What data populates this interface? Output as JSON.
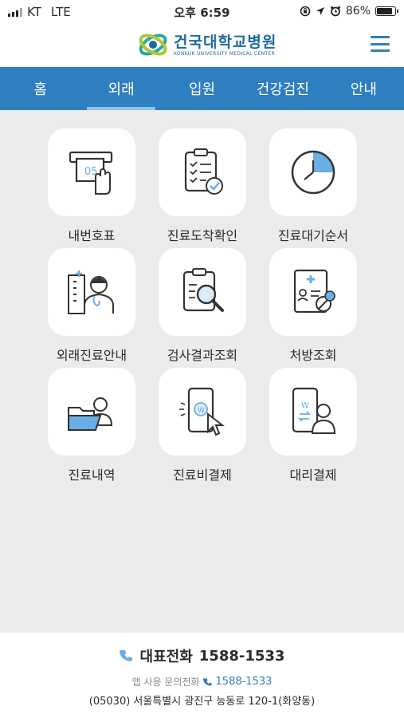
{
  "status_bar": {
    "carrier": "KT",
    "network": "LTE",
    "time": "오후 6:59",
    "battery": "86%"
  },
  "header": {
    "logo_kr": "건국대학교병원",
    "logo_en": "KONKUK UNIVERSITY MEDICAL CENTER"
  },
  "tabs": [
    {
      "label": "홈",
      "active": false
    },
    {
      "label": "외래",
      "active": true
    },
    {
      "label": "입원",
      "active": false
    },
    {
      "label": "건강검진",
      "active": false
    },
    {
      "label": "안내",
      "active": false
    }
  ],
  "menu_items": [
    {
      "label": "내번호표",
      "icon": "ticket-machine-icon"
    },
    {
      "label": "진료도착확인",
      "icon": "clipboard-check-icon"
    },
    {
      "label": "진료대기순서",
      "icon": "clock-icon"
    },
    {
      "label": "외래진료안내",
      "icon": "doctor-icon"
    },
    {
      "label": "검사결과조회",
      "icon": "clipboard-search-icon"
    },
    {
      "label": "처방조회",
      "icon": "prescription-icon"
    },
    {
      "label": "진료내역",
      "icon": "folder-user-icon"
    },
    {
      "label": "진료비결제",
      "icon": "phone-payment-icon"
    },
    {
      "label": "대리결제",
      "icon": "proxy-payment-icon"
    }
  ],
  "footer": {
    "main_label": "대표전화",
    "main_number": "1588-1533",
    "inquiry_label": "앱 사용 문의전화",
    "inquiry_number": "1588-1533",
    "address": "(05030) 서울특별시 광진구 능동로 120-1(화양동)"
  },
  "colors": {
    "brand_blue": "#2e7ec0",
    "tab_underline": "#8fc3eb",
    "icon_accent": "#6aaee6"
  }
}
